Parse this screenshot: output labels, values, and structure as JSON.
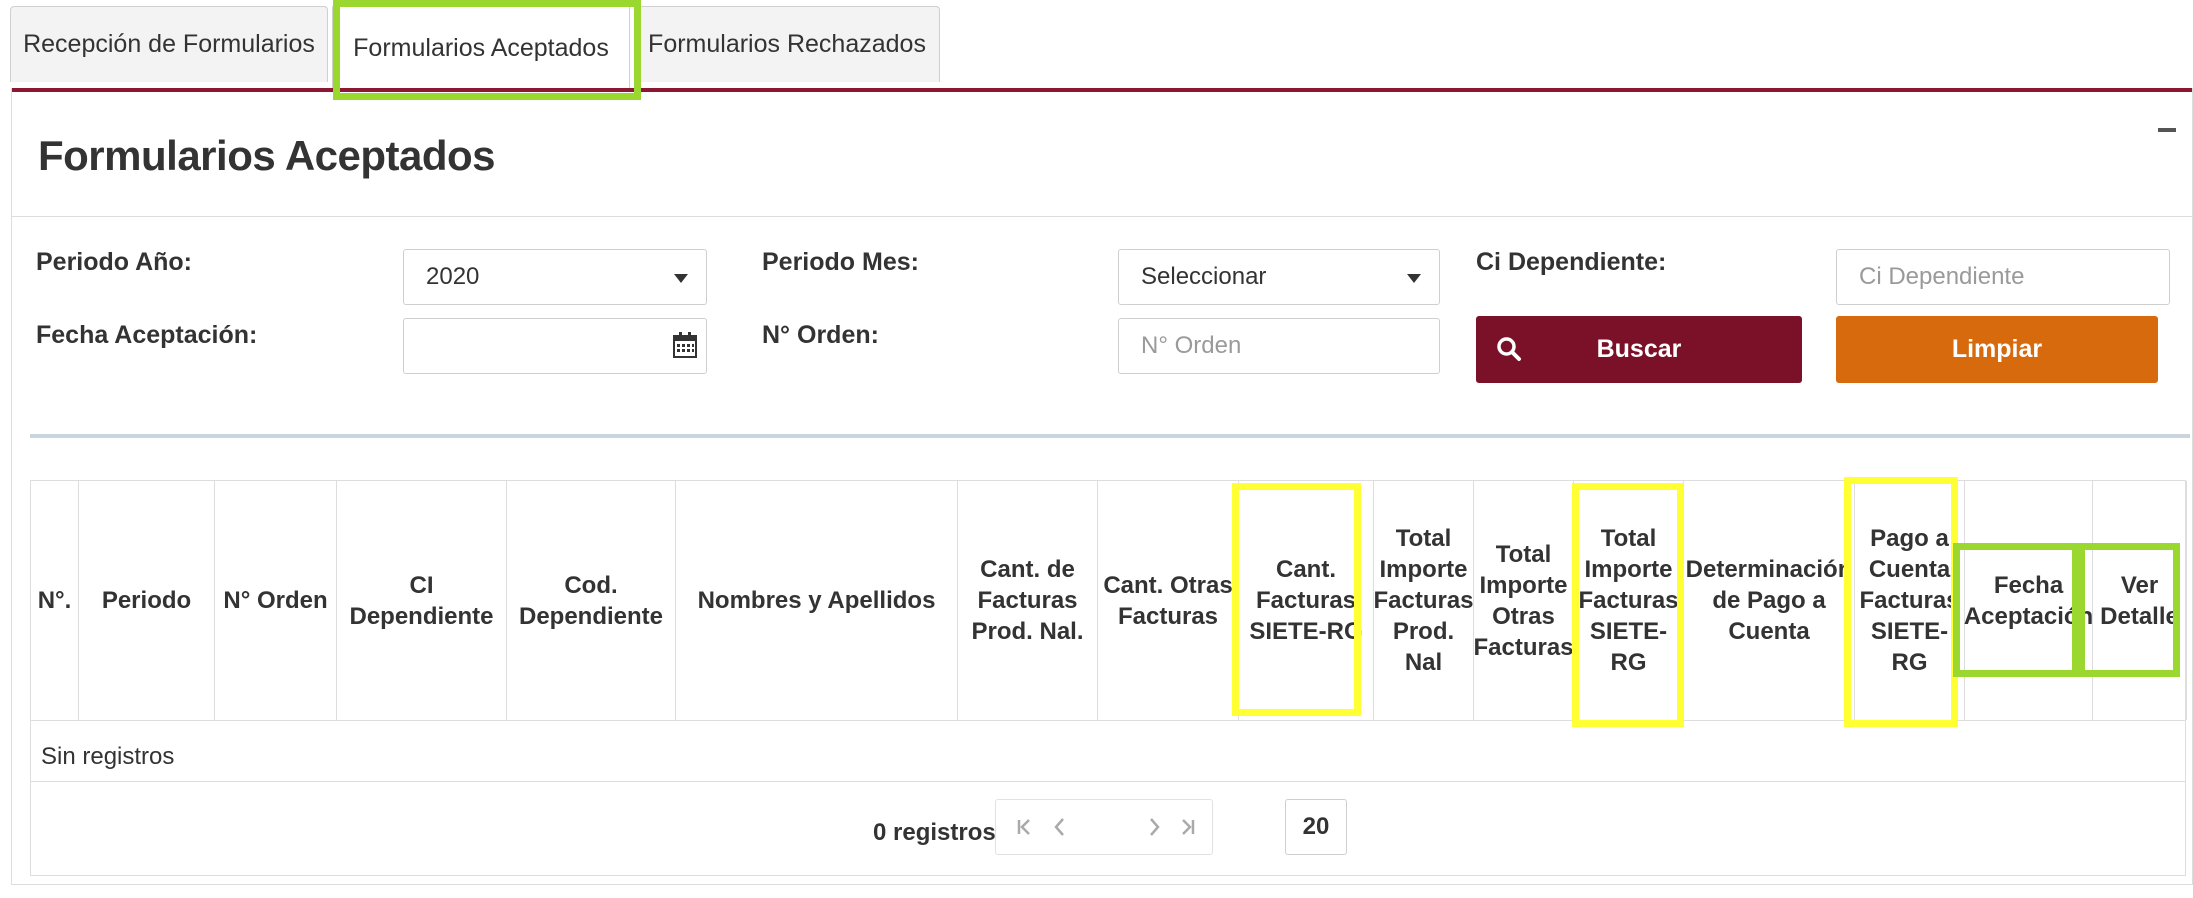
{
  "tabs": [
    {
      "label": "Recepción de Formularios"
    },
    {
      "label": "Formularios Aceptados"
    },
    {
      "label": "Formularios Rechazados"
    }
  ],
  "panel": {
    "title": "Formularios Aceptados"
  },
  "filters": {
    "periodo_anio": {
      "label": "Periodo Año:",
      "value": "2020"
    },
    "periodo_mes": {
      "label": "Periodo Mes:",
      "value": "Seleccionar"
    },
    "ci_dependiente": {
      "label": "Ci Dependiente:",
      "placeholder": "Ci Dependiente"
    },
    "fecha_aceptacion": {
      "label": "Fecha Aceptación:",
      "value": ""
    },
    "n_orden": {
      "label": "N° Orden:",
      "placeholder": "N° Orden"
    },
    "buscar_label": "Buscar",
    "limpiar_label": "Limpiar"
  },
  "table": {
    "columns": [
      "N°.",
      "Periodo",
      "N° Orden",
      "CI Dependiente",
      "Cod. Dependiente",
      "Nombres y Apellidos",
      "Cant. de Facturas Prod. Nal.",
      "Cant. Otras Facturas",
      "Cant. Facturas SIETE-RG",
      "Total Importe Facturas Prod. Nal",
      "Total Importe Otras Facturas",
      "Total Importe Facturas SIETE-RG",
      "Determinación de Pago a Cuenta",
      "Pago a Cuenta Facturas SIETE-RG",
      "Fecha Aceptación",
      "Ver Detalle"
    ],
    "empty_text": "Sin registros"
  },
  "pager": {
    "info": "0 registros",
    "page_size": "20"
  },
  "colors": {
    "brand": "#7b1129",
    "accent_orange": "#d66a0d",
    "highlight_green": "#9ad82f",
    "highlight_yellow": "#ffff33"
  },
  "icons": [
    "caret-down-icon",
    "calendar-icon",
    "search-icon",
    "first-page-icon",
    "prev-page-icon",
    "next-page-icon",
    "last-page-icon",
    "collapse-icon"
  ]
}
